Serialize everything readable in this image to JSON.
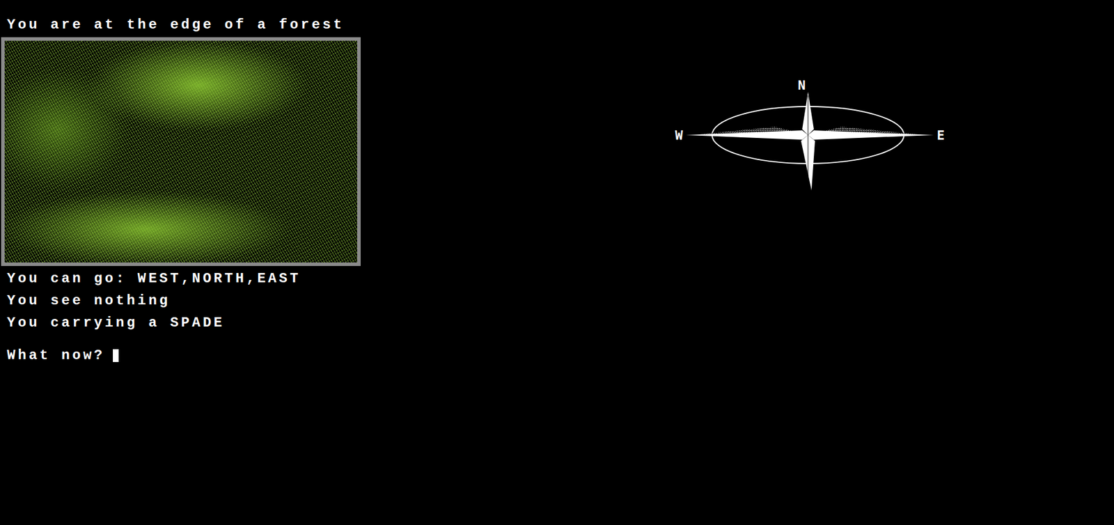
{
  "location": "You are at the edge of a forest",
  "exits": "You can go: WEST,NORTH,EAST",
  "objects": "You see nothing",
  "inventory": "You carrying a SPADE",
  "prompt": "What now?",
  "compass": {
    "north": "N",
    "west": "W",
    "east": "E"
  }
}
